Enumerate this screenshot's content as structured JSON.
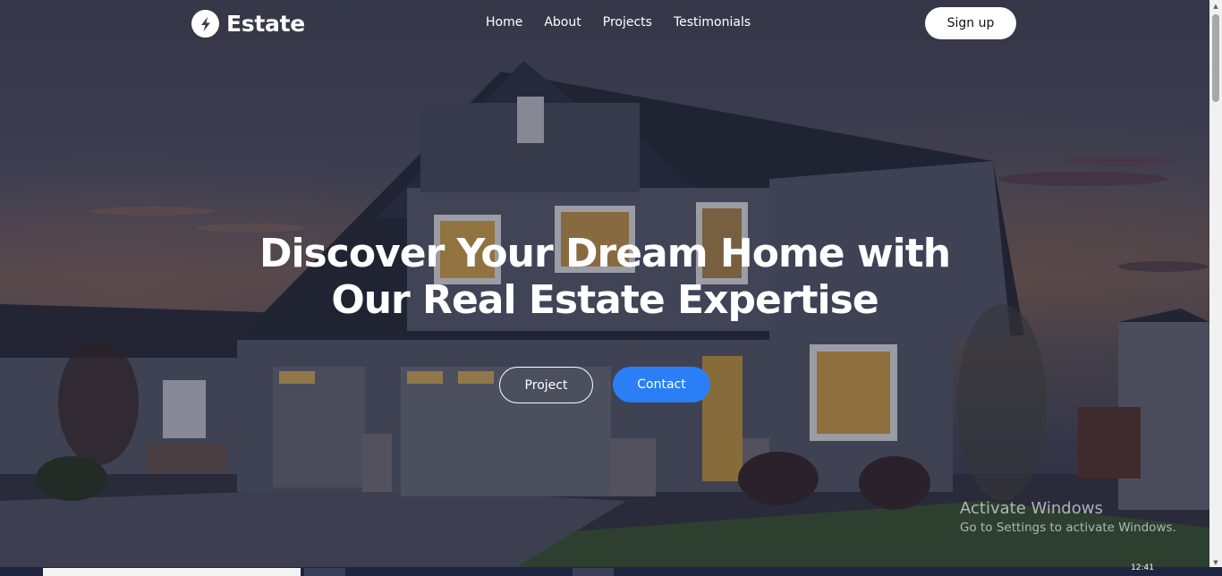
{
  "brand": {
    "name": "Estate",
    "icon": "lightning-bolt-icon"
  },
  "nav": {
    "links": [
      "Home",
      "About",
      "Projects",
      "Testimonials"
    ],
    "signup_label": "Sign up"
  },
  "hero": {
    "title_line1": "Discover Your Dream Home with",
    "title_line2": "Our Real Estate Expertise",
    "project_button": "Project",
    "contact_button": "Contact",
    "accent_color": "#2a7ff6",
    "background": "twilight house photo"
  },
  "watermark": {
    "title": "Activate Windows",
    "subtitle": "Go to Settings to activate Windows."
  },
  "taskbar": {
    "time": "12:41"
  }
}
